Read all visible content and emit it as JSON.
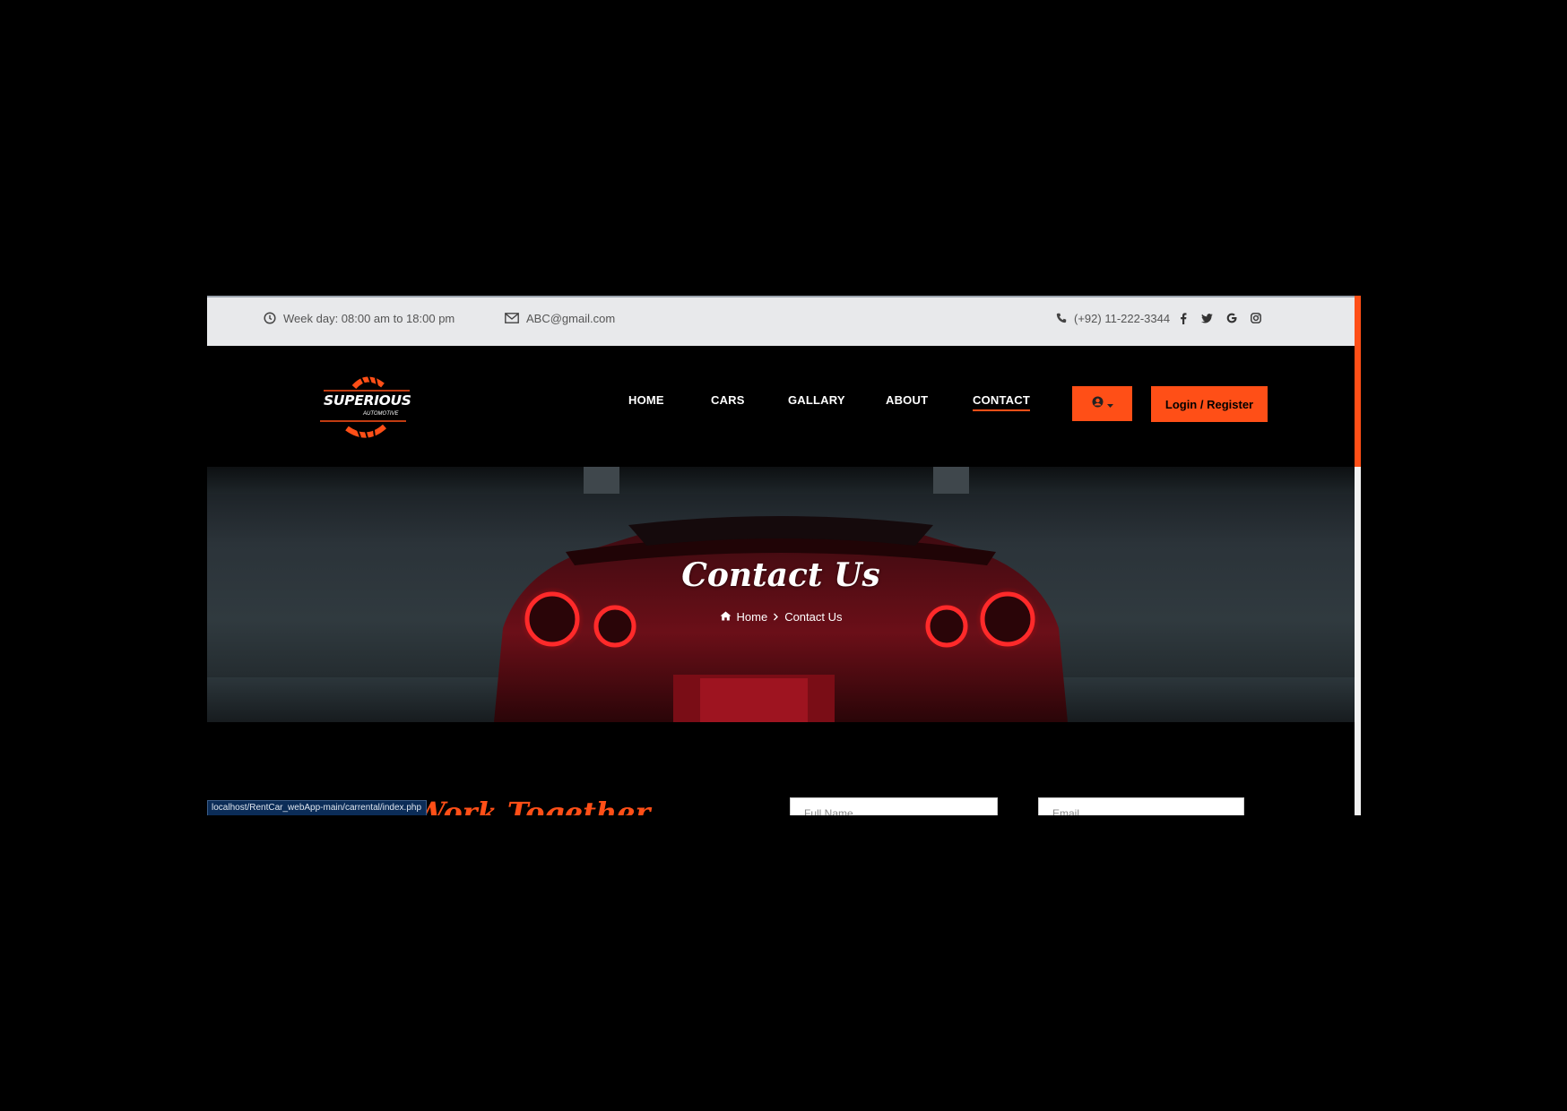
{
  "topbar": {
    "hours": "Week day: 08:00 am to 18:00 pm",
    "email": "ABC@gmail.com",
    "phone": "(+92) 11-222-3344",
    "social_icons": [
      "facebook-icon",
      "twitter-icon",
      "google-icon",
      "instagram-icon"
    ]
  },
  "logo": {
    "name": "SUPERIOUS",
    "tagline": "AUTOMOTIVE"
  },
  "nav": {
    "items": [
      {
        "label": "HOME"
      },
      {
        "label": "CARS"
      },
      {
        "label": "GALLARY"
      },
      {
        "label": "ABOUT"
      },
      {
        "label": "CONTACT",
        "active": true
      }
    ],
    "login_label": "Login / Register"
  },
  "hero": {
    "title": "Contact Us",
    "breadcrumb": {
      "home": "Home",
      "separator": ">",
      "current": "Contact Us"
    }
  },
  "contact": {
    "heading": "Work Together",
    "fields": [
      {
        "placeholder": "Full Name"
      },
      {
        "placeholder": "Email"
      }
    ]
  },
  "status_bar": {
    "url": "localhost/RentCar_webApp-main/carrental/index.php"
  },
  "colors": {
    "accent": "#ff4f17",
    "topbar_bg": "#e8e9eb",
    "page_bg": "#000000"
  }
}
